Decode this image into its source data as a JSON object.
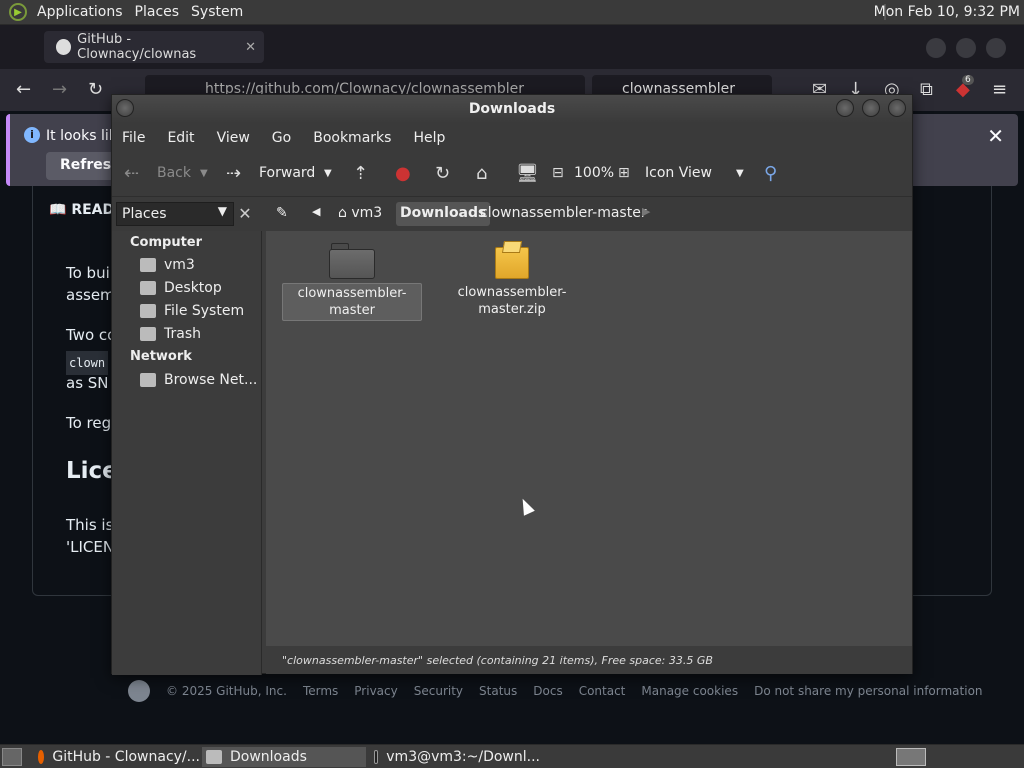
{
  "top_panel": {
    "menus": [
      "Applications",
      "Places",
      "System"
    ],
    "clock": "Mon Feb 10,  9:32 PM"
  },
  "firefox": {
    "tab_title": "GitHub - Clownacy/clownas",
    "url": "https://github.com/Clownacy/clownassembler",
    "search_text": "clownassembler",
    "notice_text": "It looks like",
    "notice_button": "Refresh F",
    "addon_badge": "6"
  },
  "github": {
    "readme_label": "READ",
    "paragraphs": [
      "To buil",
      "assem",
      "Two co",
      "clown",
      "as SN",
      "To rege"
    ],
    "license_heading": "Lice",
    "license_text_1": "This is",
    "license_text_2": "'LICEN",
    "footer": {
      "copyright": "© 2025 GitHub, Inc.",
      "links": [
        "Terms",
        "Privacy",
        "Security",
        "Status",
        "Docs",
        "Contact",
        "Manage cookies",
        "Do not share my personal information"
      ]
    }
  },
  "file_manager": {
    "title": "Downloads",
    "menus": [
      "File",
      "Edit",
      "View",
      "Go",
      "Bookmarks",
      "Help"
    ],
    "toolbar": {
      "back": "Back",
      "forward": "Forward",
      "zoom": "100%",
      "view_mode": "Icon View"
    },
    "places_combo": "Places",
    "breadcrumbs": [
      "vm3",
      "Downloads",
      "clownassembler-master"
    ],
    "sidebar": {
      "computer_header": "Computer",
      "computer_items": [
        "vm3",
        "Desktop",
        "File System",
        "Trash"
      ],
      "network_header": "Network",
      "network_items": [
        "Browse Net..."
      ]
    },
    "files": [
      {
        "name_line1": "clownassembler-",
        "name_line2": "master",
        "type": "folder",
        "selected": true
      },
      {
        "name_line1": "clownassembler-",
        "name_line2": "master.zip",
        "type": "zip",
        "selected": false
      }
    ],
    "status": "\"clownassembler-master\" selected (containing 21 items), Free space: 33.5 GB"
  },
  "taskbar": {
    "tasks": [
      "GitHub - Clownacy/...",
      "Downloads",
      "vm3@vm3:~/Downl..."
    ]
  }
}
